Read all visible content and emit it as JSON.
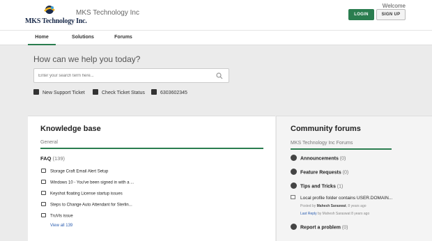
{
  "header": {
    "logo_text": "MKS Technology Inc.",
    "brand_name": "MKS Technology Inc",
    "welcome": "Welcome",
    "login_label": "LOGIN",
    "signup_label": "SIGN UP"
  },
  "nav": {
    "tabs": [
      {
        "label": "Home"
      },
      {
        "label": "Solutions"
      },
      {
        "label": "Forums"
      }
    ]
  },
  "hero": {
    "title": "How can we help you today?",
    "search_placeholder": "Enter your search term here...",
    "actions": [
      {
        "label": "New Support Ticket"
      },
      {
        "label": "Check Ticket Status"
      },
      {
        "label": "6303602345"
      }
    ]
  },
  "knowledge_base": {
    "title": "Knowledge base",
    "subtitle": "General",
    "folder": "FAQ",
    "folder_count": "(139)",
    "articles": [
      "Storage Craft Email Alert Setup",
      "Windows 10 - You've been signed in with a ...",
      "Keyshot floating License startup issues",
      "Steps to Change Auto Attendant for Sterlin...",
      "TruVis issue"
    ],
    "view_all": "View all 139"
  },
  "community": {
    "title": "Community forums",
    "subtitle": "MKS Technology Inc Forums",
    "forums": [
      {
        "label": "Announcements",
        "count": "(0)"
      },
      {
        "label": "Feature Requests",
        "count": "(0)"
      },
      {
        "label": "Tips and Tricks",
        "count": "(1)"
      }
    ],
    "post": {
      "title": "Local profile folder contains USER.DOMAIN...",
      "posted_by_prefix": "Posted by",
      "author": "Mahesh Saraswat",
      "posted_ago": ", 8 years ago",
      "last_reply_label": "Last Reply",
      "last_reply_by": "by Mahesh Saraswat 8 years ago"
    },
    "forum_last": {
      "label": "Report a problem",
      "count": "(0)"
    }
  },
  "colors": {
    "accent": "#2a7d4f",
    "link": "#2a5db0"
  }
}
